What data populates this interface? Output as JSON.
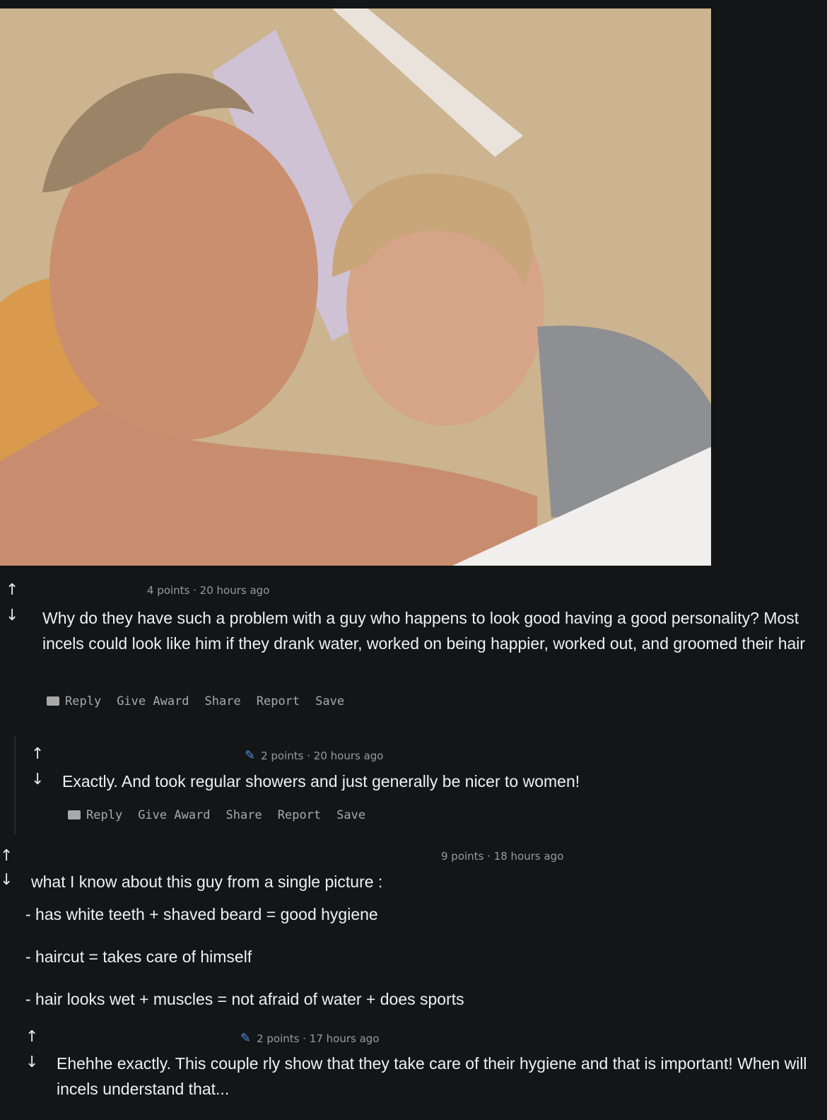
{
  "photo": {
    "alt": "beach selfie of a couple"
  },
  "comments": [
    {
      "meta": "4 points · 20 hours ago",
      "text": "Why do they have such a problem with a guy who happens to look good having a good personality? Most incels could look like him if they drank water, worked on being happier, worked out, and groomed their hair",
      "actions": [
        "Reply",
        "Give Award",
        "Share",
        "Report",
        "Save"
      ]
    },
    {
      "meta": "2 points · 20 hours ago",
      "text": "Exactly. And took regular showers and just generally be nicer to women!",
      "actions": [
        "Reply",
        "Give Award",
        "Share",
        "Report",
        "Save"
      ]
    },
    {
      "meta": "9 points · 18 hours ago",
      "lines": [
        "what I know about this guy from a single picture :",
        "- has white teeth + shaved beard = good hygiene",
        "- haircut = takes care of himself",
        "- hair looks wet + muscles = not afraid of water + does sports"
      ]
    },
    {
      "meta": "2 points · 17 hours ago",
      "text": "Ehehhe exactly. This couple rly show that they take care of their hygiene and that is important! When will incels understand that..."
    }
  ],
  "icons": {
    "upvote": "↑",
    "downvote": "↓",
    "edit": "pencil-icon",
    "reply": "chat-icon"
  }
}
